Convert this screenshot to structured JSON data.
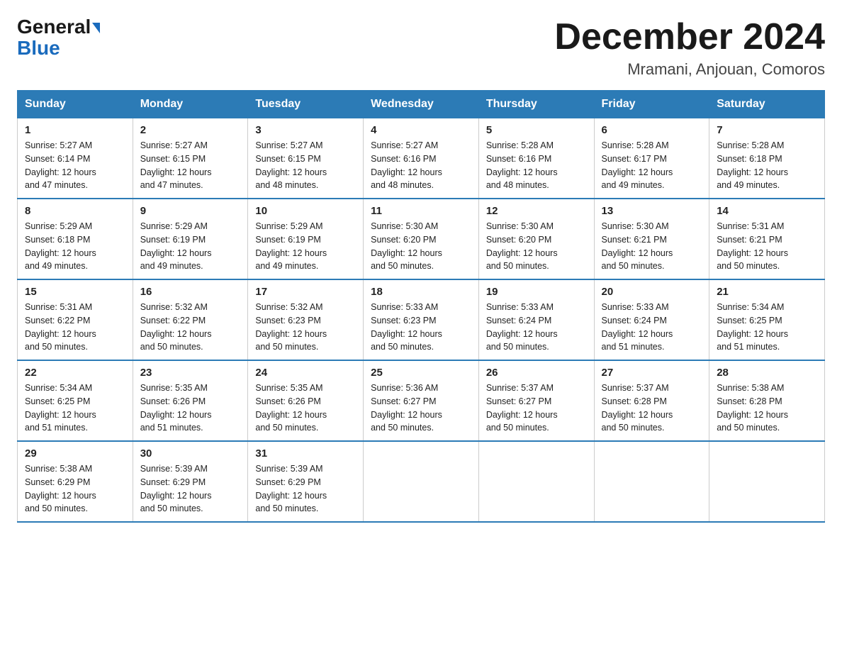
{
  "logo": {
    "part1": "General",
    "part2": "Blue"
  },
  "title": "December 2024",
  "location": "Mramani, Anjouan, Comoros",
  "days_of_week": [
    "Sunday",
    "Monday",
    "Tuesday",
    "Wednesday",
    "Thursday",
    "Friday",
    "Saturday"
  ],
  "weeks": [
    [
      {
        "day": "1",
        "sunrise": "5:27 AM",
        "sunset": "6:14 PM",
        "daylight": "12 hours and 47 minutes."
      },
      {
        "day": "2",
        "sunrise": "5:27 AM",
        "sunset": "6:15 PM",
        "daylight": "12 hours and 47 minutes."
      },
      {
        "day": "3",
        "sunrise": "5:27 AM",
        "sunset": "6:15 PM",
        "daylight": "12 hours and 48 minutes."
      },
      {
        "day": "4",
        "sunrise": "5:27 AM",
        "sunset": "6:16 PM",
        "daylight": "12 hours and 48 minutes."
      },
      {
        "day": "5",
        "sunrise": "5:28 AM",
        "sunset": "6:16 PM",
        "daylight": "12 hours and 48 minutes."
      },
      {
        "day": "6",
        "sunrise": "5:28 AM",
        "sunset": "6:17 PM",
        "daylight": "12 hours and 49 minutes."
      },
      {
        "day": "7",
        "sunrise": "5:28 AM",
        "sunset": "6:18 PM",
        "daylight": "12 hours and 49 minutes."
      }
    ],
    [
      {
        "day": "8",
        "sunrise": "5:29 AM",
        "sunset": "6:18 PM",
        "daylight": "12 hours and 49 minutes."
      },
      {
        "day": "9",
        "sunrise": "5:29 AM",
        "sunset": "6:19 PM",
        "daylight": "12 hours and 49 minutes."
      },
      {
        "day": "10",
        "sunrise": "5:29 AM",
        "sunset": "6:19 PM",
        "daylight": "12 hours and 49 minutes."
      },
      {
        "day": "11",
        "sunrise": "5:30 AM",
        "sunset": "6:20 PM",
        "daylight": "12 hours and 50 minutes."
      },
      {
        "day": "12",
        "sunrise": "5:30 AM",
        "sunset": "6:20 PM",
        "daylight": "12 hours and 50 minutes."
      },
      {
        "day": "13",
        "sunrise": "5:30 AM",
        "sunset": "6:21 PM",
        "daylight": "12 hours and 50 minutes."
      },
      {
        "day": "14",
        "sunrise": "5:31 AM",
        "sunset": "6:21 PM",
        "daylight": "12 hours and 50 minutes."
      }
    ],
    [
      {
        "day": "15",
        "sunrise": "5:31 AM",
        "sunset": "6:22 PM",
        "daylight": "12 hours and 50 minutes."
      },
      {
        "day": "16",
        "sunrise": "5:32 AM",
        "sunset": "6:22 PM",
        "daylight": "12 hours and 50 minutes."
      },
      {
        "day": "17",
        "sunrise": "5:32 AM",
        "sunset": "6:23 PM",
        "daylight": "12 hours and 50 minutes."
      },
      {
        "day": "18",
        "sunrise": "5:33 AM",
        "sunset": "6:23 PM",
        "daylight": "12 hours and 50 minutes."
      },
      {
        "day": "19",
        "sunrise": "5:33 AM",
        "sunset": "6:24 PM",
        "daylight": "12 hours and 50 minutes."
      },
      {
        "day": "20",
        "sunrise": "5:33 AM",
        "sunset": "6:24 PM",
        "daylight": "12 hours and 51 minutes."
      },
      {
        "day": "21",
        "sunrise": "5:34 AM",
        "sunset": "6:25 PM",
        "daylight": "12 hours and 51 minutes."
      }
    ],
    [
      {
        "day": "22",
        "sunrise": "5:34 AM",
        "sunset": "6:25 PM",
        "daylight": "12 hours and 51 minutes."
      },
      {
        "day": "23",
        "sunrise": "5:35 AM",
        "sunset": "6:26 PM",
        "daylight": "12 hours and 51 minutes."
      },
      {
        "day": "24",
        "sunrise": "5:35 AM",
        "sunset": "6:26 PM",
        "daylight": "12 hours and 50 minutes."
      },
      {
        "day": "25",
        "sunrise": "5:36 AM",
        "sunset": "6:27 PM",
        "daylight": "12 hours and 50 minutes."
      },
      {
        "day": "26",
        "sunrise": "5:37 AM",
        "sunset": "6:27 PM",
        "daylight": "12 hours and 50 minutes."
      },
      {
        "day": "27",
        "sunrise": "5:37 AM",
        "sunset": "6:28 PM",
        "daylight": "12 hours and 50 minutes."
      },
      {
        "day": "28",
        "sunrise": "5:38 AM",
        "sunset": "6:28 PM",
        "daylight": "12 hours and 50 minutes."
      }
    ],
    [
      {
        "day": "29",
        "sunrise": "5:38 AM",
        "sunset": "6:29 PM",
        "daylight": "12 hours and 50 minutes."
      },
      {
        "day": "30",
        "sunrise": "5:39 AM",
        "sunset": "6:29 PM",
        "daylight": "12 hours and 50 minutes."
      },
      {
        "day": "31",
        "sunrise": "5:39 AM",
        "sunset": "6:29 PM",
        "daylight": "12 hours and 50 minutes."
      },
      null,
      null,
      null,
      null
    ]
  ],
  "labels": {
    "sunrise": "Sunrise:",
    "sunset": "Sunset:",
    "daylight": "Daylight:"
  }
}
